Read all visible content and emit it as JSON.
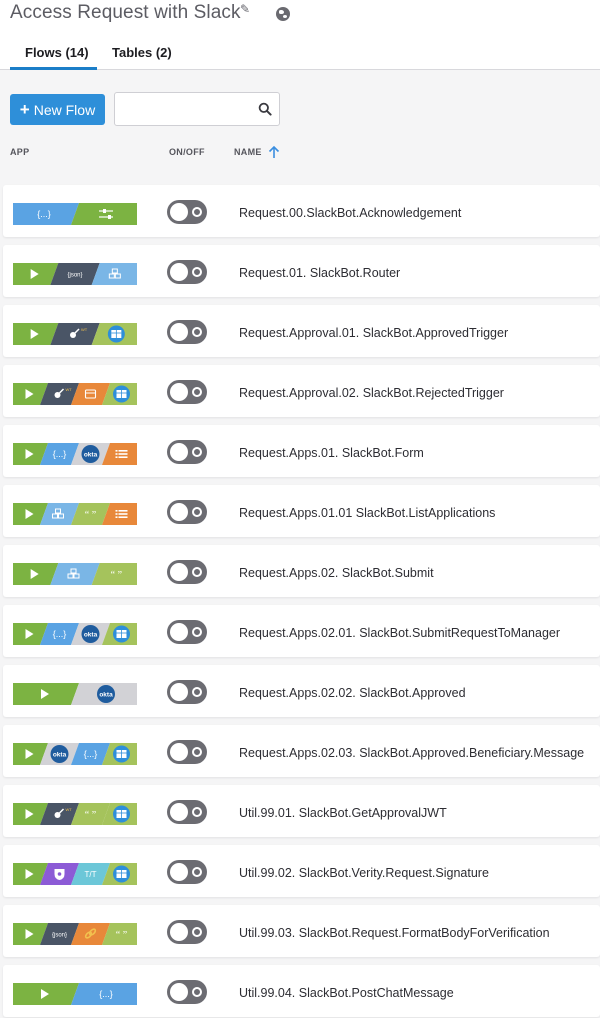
{
  "header": {
    "title": "Access Request with Slack",
    "edit_icon": "pencil-icon",
    "visibility_icon": "globe-icon"
  },
  "tabs": [
    {
      "label": "Flows (14)",
      "active": true
    },
    {
      "label": "Tables (2)",
      "active": false
    }
  ],
  "toolbar": {
    "new_flow_label": "New Flow",
    "search_value": "",
    "search_placeholder": ""
  },
  "columns": {
    "app": "APP",
    "onoff": "ON/OFF",
    "name": "NAME",
    "sort": "ascending"
  },
  "colors": {
    "accent": "#2e8fd9",
    "toggle_off": "#6c6c72",
    "green": "#7cb342",
    "dark": "#4a5566",
    "blue_light": "#7ab6e6",
    "orange": "#e8883a",
    "olive": "#a5c35c",
    "purple": "#8c5bd6",
    "teal": "#6cc7d8",
    "gray": "#d2d2d6",
    "sky": "#5aa3e3"
  },
  "flows": [
    {
      "name": "Request.00.SlackBot.Acknowledgement",
      "enabled": false,
      "apps": [
        [
          "bluesky",
          "ellipsis"
        ],
        [
          "green",
          "sliders"
        ]
      ]
    },
    {
      "name": "Request.01. SlackBot.Router",
      "enabled": false,
      "apps": [
        [
          "green",
          "play"
        ],
        [
          "dark",
          "json"
        ],
        [
          "blue_light",
          "boxes"
        ]
      ]
    },
    {
      "name": "Request.Approval.01. SlackBot.ApprovedTrigger",
      "enabled": false,
      "apps": [
        [
          "green",
          "play"
        ],
        [
          "dark",
          "jwt"
        ],
        [
          "olive",
          "table"
        ]
      ]
    },
    {
      "name": "Request.Approval.02. SlackBot.RejectedTrigger",
      "enabled": false,
      "apps": [
        [
          "green",
          "play"
        ],
        [
          "dark",
          "jwt"
        ],
        [
          "orange",
          "calendar"
        ],
        [
          "olive",
          "table"
        ]
      ]
    },
    {
      "name": "Request.Apps.01. SlackBot.Form",
      "enabled": false,
      "apps": [
        [
          "green",
          "play"
        ],
        [
          "bluesky",
          "ellipsis"
        ],
        [
          "gray",
          "okta"
        ],
        [
          "orange",
          "list"
        ]
      ]
    },
    {
      "name": "Request.Apps.01.01 SlackBot.ListApplications",
      "enabled": false,
      "apps": [
        [
          "green",
          "play"
        ],
        [
          "blue_light",
          "boxes"
        ],
        [
          "olive",
          "quote"
        ],
        [
          "orange",
          "list"
        ]
      ]
    },
    {
      "name": "Request.Apps.02. SlackBot.Submit",
      "enabled": false,
      "apps": [
        [
          "green",
          "play"
        ],
        [
          "blue_light",
          "boxes"
        ],
        [
          "olive",
          "quote"
        ]
      ]
    },
    {
      "name": "Request.Apps.02.01. SlackBot.SubmitRequestToManager",
      "enabled": false,
      "apps": [
        [
          "green",
          "play"
        ],
        [
          "bluesky",
          "ellipsis"
        ],
        [
          "gray",
          "okta"
        ],
        [
          "olive",
          "table"
        ]
      ]
    },
    {
      "name": "Request.Apps.02.02. SlackBot.Approved",
      "enabled": false,
      "apps": [
        [
          "green",
          "play"
        ],
        [
          "gray",
          "okta"
        ]
      ]
    },
    {
      "name": "Request.Apps.02.03. SlackBot.Approved.Beneficiary.Message",
      "enabled": false,
      "apps": [
        [
          "green",
          "play"
        ],
        [
          "gray",
          "okta"
        ],
        [
          "bluesky",
          "ellipsis"
        ],
        [
          "olive",
          "table"
        ]
      ]
    },
    {
      "name": "Util.99.01. SlackBot.GetApprovalJWT",
      "enabled": false,
      "apps": [
        [
          "green",
          "play"
        ],
        [
          "dark",
          "jwt"
        ],
        [
          "olive",
          "quote"
        ],
        [
          "olive",
          "table"
        ]
      ]
    },
    {
      "name": "Util.99.02. SlackBot.Verity.Request.Signature",
      "enabled": false,
      "apps": [
        [
          "green",
          "play"
        ],
        [
          "purple",
          "shield"
        ],
        [
          "teal",
          "text"
        ],
        [
          "olive",
          "table"
        ]
      ]
    },
    {
      "name": "Util.99.03. SlackBot.Request.FormatBodyForVerification",
      "enabled": false,
      "apps": [
        [
          "green",
          "play"
        ],
        [
          "dark",
          "json"
        ],
        [
          "orange",
          "link"
        ],
        [
          "olive",
          "quote"
        ]
      ]
    },
    {
      "name": "Util.99.04. SlackBot.PostChatMessage",
      "enabled": false,
      "apps": [
        [
          "green",
          "play"
        ],
        [
          "bluesky",
          "ellipsis"
        ]
      ]
    }
  ]
}
